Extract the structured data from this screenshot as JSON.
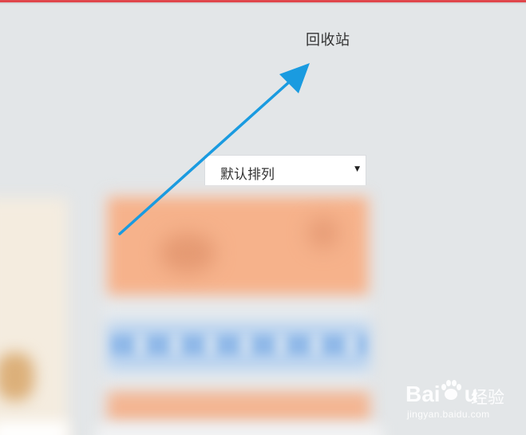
{
  "header": {
    "recycle_bin_label": "回收站"
  },
  "sort": {
    "selected": "默认排列",
    "caret": "▼"
  },
  "watermark": {
    "brand": "Bai",
    "brand_suffix": "u",
    "text": "经验",
    "url": "jingyan.baidu.com"
  },
  "colors": {
    "accent_stripe": "#e0474c",
    "arrow": "#1a9be0",
    "background": "#e3e6e8"
  }
}
